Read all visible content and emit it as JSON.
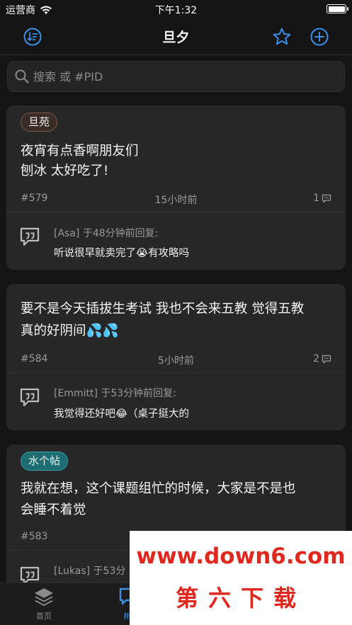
{
  "status_bar": {
    "carrier": "运营商",
    "time": "下午1:32"
  },
  "nav": {
    "title": "旦夕",
    "sort_icon": "sort-icon",
    "favorite_icon": "star-icon",
    "compose_icon": "plus-circle-icon"
  },
  "search": {
    "placeholder": "搜索 或 #PID",
    "value": ""
  },
  "posts": [
    {
      "tag": "旦苑",
      "text_lines": [
        "夜宵有点香啊朋友们",
        "刨冰 太好吃了!"
      ],
      "pid": "#579",
      "time": "15小时前",
      "reply_count": "1",
      "reply_header": "[Asa] 于48分钟前回复:",
      "reply_text": "听说很早就卖完了😭有攻略吗"
    },
    {
      "tag": "",
      "text_lines": [
        "要不是今天插拔生考试 我也不会来五教 觉得五教",
        "真的好阴间💦💦"
      ],
      "pid": "#584",
      "time": "5小时前",
      "reply_count": "2",
      "reply_header": "[Emmitt] 于53分钟前回复:",
      "reply_text": "我觉得还好吧😂（桌子挺大的"
    },
    {
      "tag": "水个帖",
      "text_lines": [
        "我就在想，这个课题组忙的时候，大家是不是也",
        "会睡不着觉"
      ],
      "pid": "#583",
      "time": "",
      "reply_count": "",
      "reply_header": "[Lukas] 于53分",
      "reply_text": ""
    }
  ],
  "tabbar": {
    "home_label": "首页",
    "second_label": "树"
  },
  "watermark": {
    "url": "www.down6.com",
    "name": "第六下载"
  },
  "colors": {
    "accent": "#3a8fe6",
    "background": "#141414",
    "card": "#272727",
    "watermark_red": "#e0281f"
  }
}
